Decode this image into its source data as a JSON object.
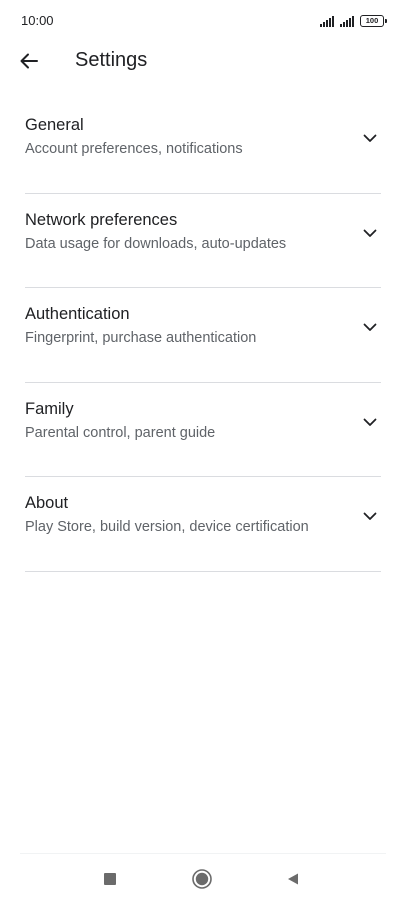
{
  "status_bar": {
    "time": "10:00",
    "battery": "100",
    "signal_icons": [
      "signal-icon",
      "signal-icon"
    ]
  },
  "app_bar": {
    "back_icon": "arrow-left-icon",
    "title": "Settings"
  },
  "settings": {
    "items": [
      {
        "title": "General",
        "subtitle": "Account preferences, notifications"
      },
      {
        "title": "Network preferences",
        "subtitle": "Data usage for downloads, auto-updates"
      },
      {
        "title": "Authentication",
        "subtitle": "Fingerprint, purchase authentication"
      },
      {
        "title": "Family",
        "subtitle": "Parental control, parent guide"
      },
      {
        "title": "About",
        "subtitle": "Play Store, build version, device certification"
      }
    ],
    "expand_icon": "chevron-down-icon"
  },
  "nav_bar": {
    "buttons": [
      "recents-square-icon",
      "home-circle-icon",
      "back-triangle-icon"
    ]
  },
  "colors": {
    "background": "#ffffff",
    "text_primary": "#202124",
    "text_secondary": "#5f6368",
    "divider": "#dadce0",
    "nav_icon": "#6b6b6b"
  }
}
